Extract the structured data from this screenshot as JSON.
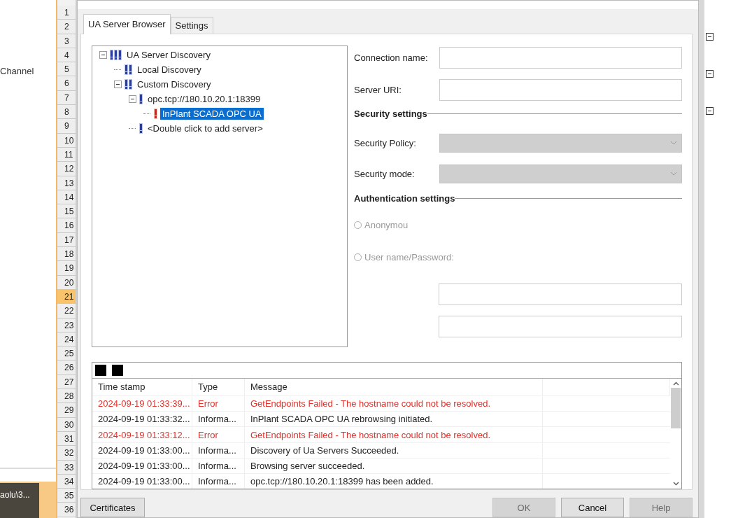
{
  "background": {
    "label": "Channel",
    "taskbar_item": "aolu\\3..."
  },
  "row_headers": [
    {
      "label": "1",
      "selected": false
    },
    {
      "label": "2",
      "selected": false
    },
    {
      "label": "3",
      "selected": false
    },
    {
      "label": "4",
      "selected": false
    },
    {
      "label": "5",
      "selected": false
    },
    {
      "label": "6",
      "selected": false
    },
    {
      "label": "7",
      "selected": false
    },
    {
      "label": "8",
      "selected": false
    },
    {
      "label": "9",
      "selected": false
    },
    {
      "label": "10",
      "selected": false
    },
    {
      "label": "11",
      "selected": false
    },
    {
      "label": "12",
      "selected": false
    },
    {
      "label": "13",
      "selected": false
    },
    {
      "label": "14",
      "selected": false
    },
    {
      "label": "15",
      "selected": false
    },
    {
      "label": "16",
      "selected": false
    },
    {
      "label": "17",
      "selected": false
    },
    {
      "label": "18",
      "selected": false
    },
    {
      "label": "19",
      "selected": false
    },
    {
      "label": "20",
      "selected": false
    },
    {
      "label": "21",
      "selected": true
    },
    {
      "label": "22",
      "selected": false
    },
    {
      "label": "23",
      "selected": false
    },
    {
      "label": "24",
      "selected": false
    },
    {
      "label": "25",
      "selected": false
    },
    {
      "label": "26",
      "selected": false
    },
    {
      "label": "27",
      "selected": false
    },
    {
      "label": "28",
      "selected": false
    },
    {
      "label": "29",
      "selected": false
    },
    {
      "label": "30",
      "selected": false
    },
    {
      "label": "31",
      "selected": false
    },
    {
      "label": "32",
      "selected": false
    },
    {
      "label": "33",
      "selected": false
    },
    {
      "label": "34",
      "selected": false
    },
    {
      "label": "35",
      "selected": false
    },
    {
      "label": "36",
      "selected": false
    }
  ],
  "tabs": [
    {
      "label": "UA Server Browser",
      "selected": true
    },
    {
      "label": "Settings",
      "selected": false
    }
  ],
  "tree": [
    {
      "label": "UA Server Discovery",
      "kind": "group",
      "expanded": true,
      "selected": false,
      "children": [
        {
          "label": "Local Discovery",
          "kind": "discovery",
          "selected": false
        },
        {
          "label": "Custom Discovery",
          "kind": "discovery",
          "expanded": true,
          "selected": false,
          "children": [
            {
              "label": "opc.tcp://180.10.20.1:18399",
              "kind": "server",
              "expanded": true,
              "selected": false,
              "children": [
                {
                  "label": "InPlant SCADA OPC UA",
                  "kind": "error",
                  "selected": true
                }
              ]
            },
            {
              "label": "<Double click to add server>",
              "kind": "server",
              "selected": false
            }
          ]
        }
      ]
    }
  ],
  "form": {
    "connection_name": {
      "label": "Connection name:"
    },
    "server_uri": {
      "label": "Server URI:"
    },
    "security_heading": "Security settings",
    "security_policy": {
      "label": "Security Policy:",
      "disabled": true
    },
    "security_mode": {
      "label": "Security mode:",
      "disabled": true
    },
    "auth_heading": "Authentication settings",
    "auth_options": [
      {
        "label": "Anonymou",
        "selected": false,
        "disabled": true
      },
      {
        "label": "User name/Password:",
        "selected": false,
        "disabled": true
      }
    ]
  },
  "log": {
    "columns": [
      "Time stamp",
      "Type",
      "Message"
    ],
    "rows": [
      {
        "kind": "error",
        "time": "2024-09-19 01:33:39...",
        "type": "Error",
        "message": "GetEndpoints Failed - The hostname could not be resolved."
      },
      {
        "kind": "info",
        "time": "2024-09-19 01:33:32...",
        "type": "Informa...",
        "message": "InPlant SCADA OPC UA rebrowsing initiated."
      },
      {
        "kind": "error",
        "time": "2024-09-19 01:33:12...",
        "type": "Error",
        "message": "GetEndpoints Failed - The hostname could not be resolved."
      },
      {
        "kind": "info",
        "time": "2024-09-19 01:33:00...",
        "type": "Informa...",
        "message": "Discovery of Ua Servers Succeeded."
      },
      {
        "kind": "info",
        "time": "2024-09-19 01:33:00...",
        "type": "Informa...",
        "message": "Browsing server succeeded."
      },
      {
        "kind": "info",
        "time": "2024-09-19 01:33:00...",
        "type": "Informa...",
        "message": "opc.tcp://180.10.20.1:18399 has been added."
      }
    ]
  },
  "buttons": [
    {
      "label": "Certificates",
      "disabled": false
    },
    {
      "label": "OK",
      "disabled": true
    },
    {
      "label": "Cancel",
      "disabled": false
    },
    {
      "label": "Help",
      "disabled": true
    }
  ]
}
